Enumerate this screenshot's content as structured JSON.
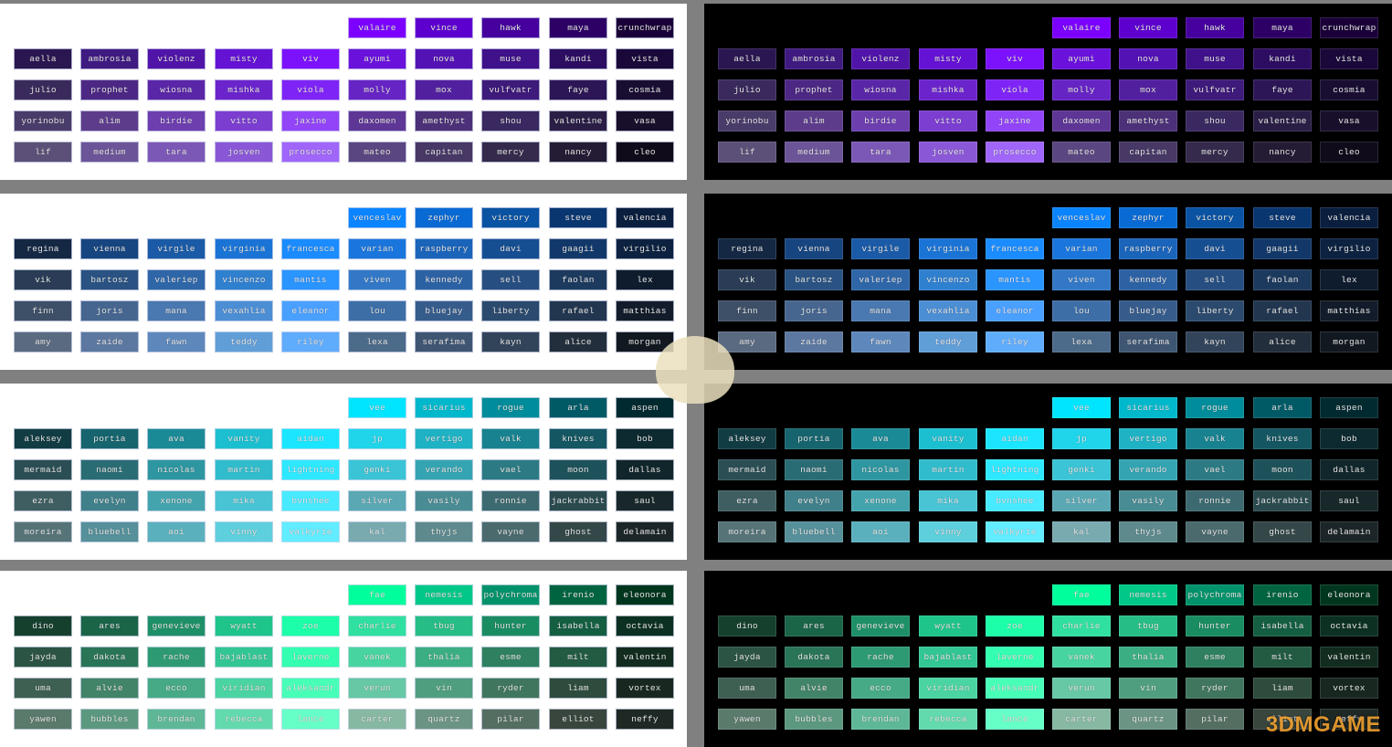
{
  "watermark": {
    "logo_text": "3DMGAME"
  },
  "palettes": [
    {
      "top": [
        [
          "valaire",
          "#7b00ff"
        ],
        [
          "vince",
          "#5d00cf"
        ],
        [
          "hawk",
          "#45009e"
        ],
        [
          "maya",
          "#2d0066"
        ],
        [
          "crunchwrap",
          "#1a0038"
        ]
      ],
      "rows": [
        [
          [
            "aella",
            "#2a1650"
          ],
          [
            "ambrosia",
            "#3f1a80"
          ],
          [
            "violenz",
            "#5114a8"
          ],
          [
            "misty",
            "#6412d4"
          ],
          [
            "viv",
            "#7c12fc"
          ],
          [
            "ayumi",
            "#6a12dc"
          ],
          [
            "nova",
            "#5313b4"
          ],
          [
            "muse",
            "#3f118a"
          ],
          [
            "kandi",
            "#2d0d62"
          ],
          [
            "vista",
            "#1a083a"
          ]
        ],
        [
          [
            "julio",
            "#3a2a5c"
          ],
          [
            "prophet",
            "#4c2884"
          ],
          [
            "wiosna",
            "#5a26a8"
          ],
          [
            "mishka",
            "#6b24cc"
          ],
          [
            "viola",
            "#7f24f6"
          ],
          [
            "molly",
            "#6624c4"
          ],
          [
            "mox",
            "#51209e"
          ],
          [
            "vulfvatr",
            "#3e1a7a"
          ],
          [
            "faye",
            "#2c1656"
          ],
          [
            "cosmia",
            "#190e32"
          ]
        ],
        [
          [
            "yorinobu",
            "#4a3c6a"
          ],
          [
            "alim",
            "#5d3c8c"
          ],
          [
            "birdie",
            "#6c3eae"
          ],
          [
            "vitto",
            "#7b3ed0"
          ],
          [
            "jaxine",
            "#9144f8"
          ],
          [
            "daxomen",
            "#5e3696"
          ],
          [
            "amethyst",
            "#4c3078"
          ],
          [
            "shou",
            "#3a2860"
          ],
          [
            "valentine",
            "#2a1e46"
          ],
          [
            "vasa",
            "#180f2a"
          ]
        ],
        [
          [
            "lif",
            "#5c5078"
          ],
          [
            "medium",
            "#6c5498"
          ],
          [
            "tara",
            "#7c58b6"
          ],
          [
            "josven",
            "#8a58d6"
          ],
          [
            "prosecco",
            "#a066fa"
          ],
          [
            "mateo",
            "#5a4680"
          ],
          [
            "capitan",
            "#473866"
          ],
          [
            "mercy",
            "#352a4c"
          ],
          [
            "nancy",
            "#241c34"
          ],
          [
            "cleo",
            "#100b1a"
          ]
        ]
      ]
    },
    {
      "top": [
        [
          "venceslav",
          "#0a84ff"
        ],
        [
          "zephyr",
          "#0a6ad4"
        ],
        [
          "victory",
          "#0a52a2"
        ],
        [
          "steve",
          "#0a3670"
        ],
        [
          "valencia",
          "#0a1e3e"
        ]
      ],
      "rows": [
        [
          [
            "regina",
            "#142844"
          ],
          [
            "vienna",
            "#174580"
          ],
          [
            "virgile",
            "#1a5aa6"
          ],
          [
            "virginia",
            "#1a74d6"
          ],
          [
            "francesca",
            "#1a8cff"
          ],
          [
            "varian",
            "#1a76dc"
          ],
          [
            "raspberry",
            "#1a64ba"
          ],
          [
            "davi",
            "#164e92"
          ],
          [
            "gaagii",
            "#12386a"
          ],
          [
            "virgilio",
            "#0c2240"
          ]
        ],
        [
          [
            "vik",
            "#2a3c56"
          ],
          [
            "bartosz",
            "#2a5282"
          ],
          [
            "valeriep",
            "#2e66a8"
          ],
          [
            "vincenzo",
            "#3080d0"
          ],
          [
            "mantis",
            "#2a94ff"
          ],
          [
            "viven",
            "#3278c6"
          ],
          [
            "kennedy",
            "#2c62a4"
          ],
          [
            "sell",
            "#264e80"
          ],
          [
            "faolan",
            "#1c3a5e"
          ],
          [
            "lex",
            "#0e1c2e"
          ]
        ],
        [
          [
            "finn",
            "#3e5068"
          ],
          [
            "joris",
            "#466690"
          ],
          [
            "mana",
            "#4a78b0"
          ],
          [
            "vexahlia",
            "#4c8ed4"
          ],
          [
            "eleanor",
            "#4aa0ff"
          ],
          [
            "lou",
            "#3e6ea6"
          ],
          [
            "bluejay",
            "#365c8c"
          ],
          [
            "liberty",
            "#2c4a6e"
          ],
          [
            "rafael",
            "#223650"
          ],
          [
            "matthias",
            "#121c2a"
          ]
        ],
        [
          [
            "amy",
            "#5a6a80"
          ],
          [
            "zaide",
            "#5c78a0"
          ],
          [
            "fawn",
            "#5e88bc"
          ],
          [
            "teddy",
            "#609ed8"
          ],
          [
            "riley",
            "#60acfc"
          ],
          [
            "lexa",
            "#4c6a8a"
          ],
          [
            "serafima",
            "#3e5672"
          ],
          [
            "kayn",
            "#32445a"
          ],
          [
            "alice",
            "#222e3c"
          ],
          [
            "morgan",
            "#121820"
          ]
        ]
      ]
    },
    {
      "top": [
        [
          "vee",
          "#00e5ff"
        ],
        [
          "sicarius",
          "#00b8cc"
        ],
        [
          "rogue",
          "#008c9a"
        ],
        [
          "arla",
          "#005a66"
        ],
        [
          "aspen",
          "#002a30"
        ]
      ],
      "rows": [
        [
          [
            "aleksey",
            "#123c44"
          ],
          [
            "portia",
            "#16646e"
          ],
          [
            "ava",
            "#1a8a96"
          ],
          [
            "vanity",
            "#1cbfd0"
          ],
          [
            "aidan",
            "#1ce6ff"
          ],
          [
            "jp",
            "#20d4ea"
          ],
          [
            "vertigo",
            "#1eb2c4"
          ],
          [
            "valk",
            "#188290"
          ],
          [
            "knives",
            "#145662"
          ],
          [
            "bob",
            "#0c2a30"
          ]
        ],
        [
          [
            "mermaid",
            "#2a4e54"
          ],
          [
            "naomi",
            "#2a6c74"
          ],
          [
            "nicolas",
            "#2e96a0"
          ],
          [
            "martin",
            "#30bccc"
          ],
          [
            "lightning",
            "#2ee8ff"
          ],
          [
            "genki",
            "#3ac4d6"
          ],
          [
            "verando",
            "#34a4b2"
          ],
          [
            "vael",
            "#2c7a84"
          ],
          [
            "moon",
            "#1e525a"
          ],
          [
            "dallas",
            "#10262a"
          ]
        ],
        [
          [
            "ezra",
            "#3e5e62"
          ],
          [
            "evelyn",
            "#40808a"
          ],
          [
            "xenone",
            "#44a4ae"
          ],
          [
            "mika",
            "#48c4d4"
          ],
          [
            "bvnshee",
            "#48eaff"
          ],
          [
            "silver",
            "#5aa8b4"
          ],
          [
            "vasily",
            "#4a8c94"
          ],
          [
            "ronnie",
            "#3c6a70"
          ],
          [
            "jackrabbit",
            "#2a4a4e"
          ],
          [
            "saul",
            "#18282a"
          ]
        ],
        [
          [
            "moreira",
            "#567478"
          ],
          [
            "bluebell",
            "#56909a"
          ],
          [
            "aoi",
            "#5ab0bc"
          ],
          [
            "vinny",
            "#5ecfdc"
          ],
          [
            "valkyrie",
            "#62ecff"
          ],
          [
            "kal",
            "#78aab0"
          ],
          [
            "thyjs",
            "#5e8a8e"
          ],
          [
            "vayne",
            "#4a6a6e"
          ],
          [
            "ghost",
            "#34484a"
          ],
          [
            "delamain",
            "#1c2628"
          ]
        ]
      ]
    },
    {
      "top": [
        [
          "fae",
          "#00ff9c"
        ],
        [
          "nemesis",
          "#00c888"
        ],
        [
          "polychroma",
          "#00926a"
        ],
        [
          "irenio",
          "#006440"
        ],
        [
          "eleonora",
          "#00361e"
        ]
      ],
      "rows": [
        [
          [
            "dino",
            "#16402e"
          ],
          [
            "ares",
            "#1a6448"
          ],
          [
            "genevieve",
            "#1e9068"
          ],
          [
            "wyatt",
            "#1ec48a"
          ],
          [
            "zoe",
            "#1cffa8"
          ],
          [
            "charlie",
            "#30e0a0"
          ],
          [
            "tbug",
            "#26be86"
          ],
          [
            "hunter",
            "#1a8c62"
          ],
          [
            "isabella",
            "#145e42"
          ],
          [
            "octavia",
            "#0c3022"
          ]
        ],
        [
          [
            "jayda",
            "#2c5444"
          ],
          [
            "dakota",
            "#2a7458"
          ],
          [
            "rache",
            "#2e9a74"
          ],
          [
            "bajablast",
            "#32c694"
          ],
          [
            "laverne",
            "#34ffb0"
          ],
          [
            "vanek",
            "#48d4a0"
          ],
          [
            "thalia",
            "#3cae84"
          ],
          [
            "esme",
            "#2e8060"
          ],
          [
            "milt",
            "#225a42"
          ],
          [
            "valentin",
            "#122c20"
          ]
        ],
        [
          [
            "uma",
            "#3e6052"
          ],
          [
            "alvie",
            "#428468"
          ],
          [
            "ecco",
            "#46aa86"
          ],
          [
            "viridian",
            "#4ad4a2"
          ],
          [
            "aleksandr",
            "#48ffb8"
          ],
          [
            "verun",
            "#66c8a4"
          ],
          [
            "vin",
            "#509e80"
          ],
          [
            "ryder",
            "#40765e"
          ],
          [
            "liam",
            "#2e4c3e"
          ],
          [
            "vortex",
            "#182820"
          ]
        ],
        [
          [
            "yawen",
            "#5a7a6c"
          ],
          [
            "bubbles",
            "#5c9880"
          ],
          [
            "brendan",
            "#5eb898"
          ],
          [
            "rebecca",
            "#62daae"
          ],
          [
            "lance",
            "#66ffc8"
          ],
          [
            "carter",
            "#86b8a2"
          ],
          [
            "quartz",
            "#6c9484"
          ],
          [
            "pilar",
            "#546e62"
          ],
          [
            "elliot",
            "#38463e"
          ],
          [
            "neffy",
            "#1e2824"
          ]
        ]
      ]
    }
  ]
}
